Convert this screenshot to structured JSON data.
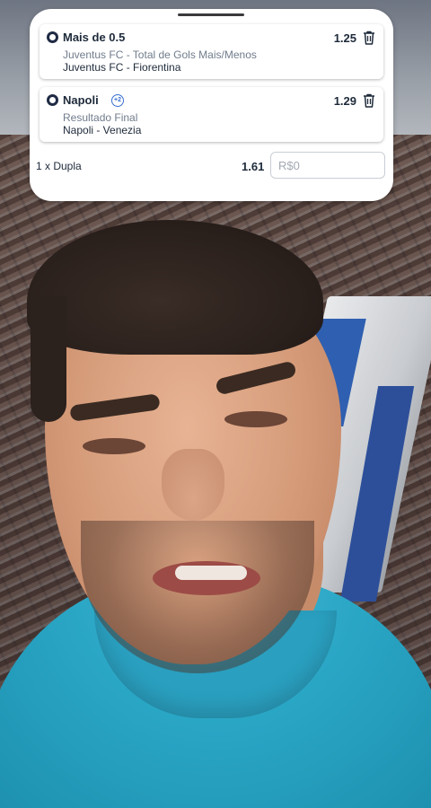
{
  "bet_slip": {
    "selections": [
      {
        "title": "Mais de 0.5",
        "market": "Juventus FC - Total de Gols Mais/Menos",
        "match": "Juventus FC - Fiorentina",
        "odds": "1.25",
        "icon": "soccer-ball-icon"
      },
      {
        "title": "Napoli",
        "badge": "+2",
        "market": "Resultado Final",
        "match": "Napoli - Venezia",
        "odds": "1.29",
        "icon": "soccer-ball-icon"
      }
    ],
    "footer": {
      "bet_type": "1 x Dupla",
      "total_odds": "1.61",
      "stake_placeholder": "R$0"
    }
  },
  "colors": {
    "card_bg": "#ffffff",
    "text_primary": "#1e2a3a",
    "text_secondary": "#707c8c",
    "shirt": "#2aa6c5"
  }
}
